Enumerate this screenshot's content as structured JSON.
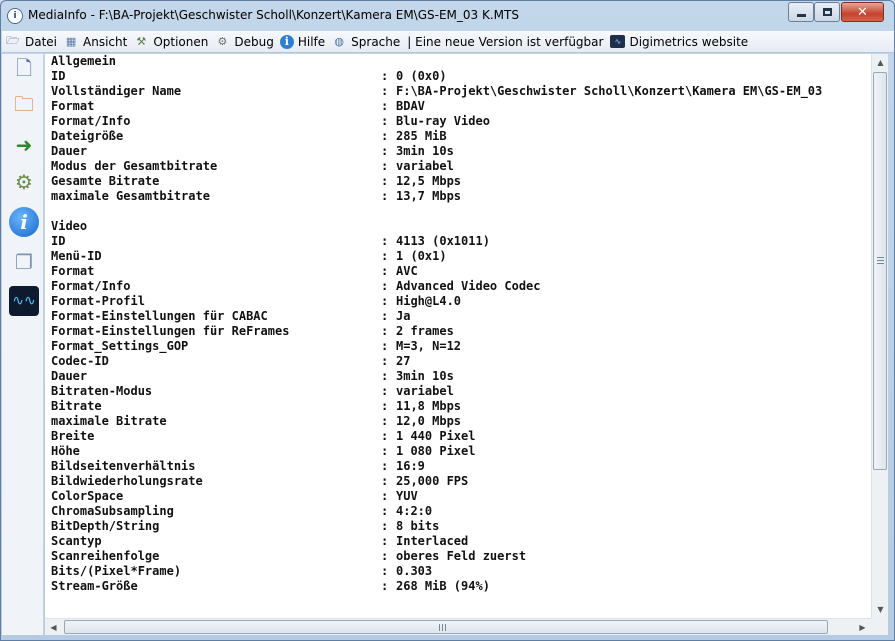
{
  "window": {
    "title": "MediaInfo - F:\\BA-Projekt\\Geschwister Scholl\\Konzert\\Kamera EM\\GS-EM_03 K.MTS",
    "app_icon": "mediainfo-icon",
    "buttons": {
      "minimize": "minimize-icon",
      "maximize": "maximize-icon",
      "close": "close-icon"
    }
  },
  "menu": {
    "items": [
      {
        "label": "Datei",
        "icon": "file-icon"
      },
      {
        "label": "Ansicht",
        "icon": "view-icon"
      },
      {
        "label": "Optionen",
        "icon": "options-icon"
      },
      {
        "label": "Debug",
        "icon": "debug-icon"
      },
      {
        "label": "Hilfe",
        "icon": "help-icon"
      },
      {
        "label": "Sprache",
        "icon": "language-icon"
      }
    ],
    "update_notice": "| Eine neue Version ist verfügbar",
    "website_label": "Digimetrics website"
  },
  "sidebar": {
    "icons": [
      "open-file-icon",
      "open-folder-icon",
      "export-info-icon",
      "settings-icon",
      "info-icon",
      "sheet-view-icon",
      "digimetrics-icon"
    ]
  },
  "info": {
    "sections": [
      {
        "title": "Allgemein",
        "rows": [
          {
            "key": "ID",
            "value": "0 (0x0)"
          },
          {
            "key": "Vollständiger Name",
            "value": "F:\\BA-Projekt\\Geschwister Scholl\\Konzert\\Kamera EM\\GS-EM_03"
          },
          {
            "key": "Format",
            "value": "BDAV"
          },
          {
            "key": "Format/Info",
            "value": "Blu-ray Video"
          },
          {
            "key": "Dateigröße",
            "value": "285 MiB"
          },
          {
            "key": "Dauer",
            "value": "3min 10s"
          },
          {
            "key": "Modus der Gesamtbitrate",
            "value": "variabel"
          },
          {
            "key": "Gesamte Bitrate",
            "value": "12,5 Mbps"
          },
          {
            "key": "maximale Gesamtbitrate",
            "value": "13,7 Mbps"
          }
        ]
      },
      {
        "title": "Video",
        "rows": [
          {
            "key": "ID",
            "value": "4113 (0x1011)"
          },
          {
            "key": "Menü-ID",
            "value": "1 (0x1)"
          },
          {
            "key": "Format",
            "value": "AVC"
          },
          {
            "key": "Format/Info",
            "value": "Advanced Video Codec"
          },
          {
            "key": "Format-Profil",
            "value": "High@L4.0"
          },
          {
            "key": "Format-Einstellungen für CABAC",
            "value": "Ja"
          },
          {
            "key": "Format-Einstellungen für ReFrames",
            "value": "2 frames"
          },
          {
            "key": "Format_Settings_GOP",
            "value": "M=3, N=12"
          },
          {
            "key": "Codec-ID",
            "value": "27"
          },
          {
            "key": "Dauer",
            "value": "3min 10s"
          },
          {
            "key": "Bitraten-Modus",
            "value": "variabel"
          },
          {
            "key": "Bitrate",
            "value": "11,8 Mbps"
          },
          {
            "key": "maximale Bitrate",
            "value": "12,0 Mbps"
          },
          {
            "key": "Breite",
            "value": "1 440 Pixel"
          },
          {
            "key": "Höhe",
            "value": "1 080 Pixel"
          },
          {
            "key": "Bildseitenverhältnis",
            "value": "16:9"
          },
          {
            "key": "Bildwiederholungsrate",
            "value": "25,000 FPS"
          },
          {
            "key": "ColorSpace",
            "value": "YUV"
          },
          {
            "key": "ChromaSubsampling",
            "value": "4:2:0"
          },
          {
            "key": "BitDepth/String",
            "value": "8 bits"
          },
          {
            "key": "Scantyp",
            "value": "Interlaced"
          },
          {
            "key": "Scanreihenfolge",
            "value": "oberes Feld zuerst"
          },
          {
            "key": "Bits/(Pixel*Frame)",
            "value": "0.303"
          },
          {
            "key": "Stream-Größe",
            "value": "268 MiB (94%)"
          }
        ]
      }
    ],
    "separator": ":"
  }
}
